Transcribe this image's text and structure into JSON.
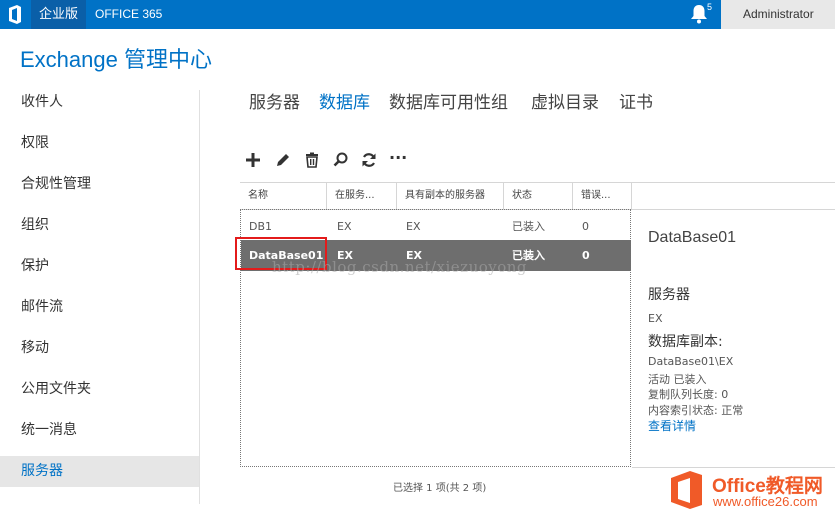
{
  "topbar": {
    "edition": "企业版",
    "product": "OFFICE 365",
    "notification_count": "5",
    "user": "Administrator"
  },
  "app_title": "Exchange 管理中心",
  "nav": {
    "items": [
      {
        "label": "收件人"
      },
      {
        "label": "权限"
      },
      {
        "label": "合规性管理"
      },
      {
        "label": "组织"
      },
      {
        "label": "保护"
      },
      {
        "label": "邮件流"
      },
      {
        "label": "移动"
      },
      {
        "label": "公用文件夹"
      },
      {
        "label": "统一消息"
      },
      {
        "label": "服务器"
      }
    ],
    "active": "服务器"
  },
  "tabs": [
    {
      "label": "服务器"
    },
    {
      "label": "数据库"
    },
    {
      "label": "数据库可用性组"
    },
    {
      "label": "虚拟目录"
    },
    {
      "label": "证书"
    }
  ],
  "active_tab": "数据库",
  "toolbar": {
    "icons": [
      "add-icon",
      "edit-icon",
      "delete-icon",
      "search-icon",
      "refresh-icon",
      "more-icon"
    ],
    "more_label": "···"
  },
  "grid": {
    "columns": [
      "名称",
      "在服务...",
      "具有副本的服务器",
      "状态",
      "错误..."
    ],
    "rows": [
      {
        "name": "DB1",
        "server": "EX",
        "copies": "EX",
        "status": "已装入",
        "errors": "0"
      },
      {
        "name": "DataBase01",
        "server": "EX",
        "copies": "EX",
        "status": "已装入",
        "errors": "0"
      }
    ],
    "selected_row": "DataBase01",
    "selection_info": "已选择 1 项(共 2 项)"
  },
  "watermark": "http://blog.csdn.net/xiezuoyong",
  "details": {
    "title": "DataBase01",
    "server_heading": "服务器",
    "server_value": "EX",
    "copies_heading": "数据库副本:",
    "copy_name": "DataBase01\\EX",
    "copy_status": "活动 已装入",
    "copy_queue": "复制队列长度: 0",
    "content_index": "内容索引状态: 正常",
    "view_details": "查看详情"
  },
  "logo": {
    "line1": "Office教程网",
    "line2": "www.office26.com"
  },
  "colors": {
    "accent": "#0072c6",
    "selected_row": "#6e6e6e",
    "highlight_box": "#e31b1b",
    "logo": "#f05a28"
  }
}
